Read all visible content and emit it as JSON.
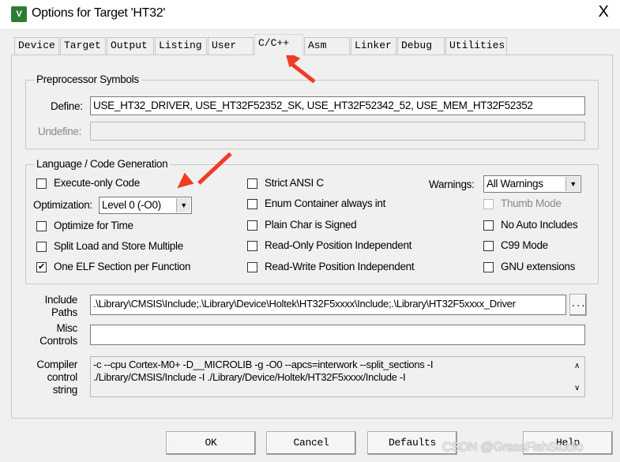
{
  "window": {
    "title": "Options for Target 'HT32'",
    "icon": "keil-uvision-icon",
    "close": "X"
  },
  "tabs": [
    {
      "label": "Device"
    },
    {
      "label": "Target"
    },
    {
      "label": "Output"
    },
    {
      "label": "Listing"
    },
    {
      "label": "User"
    },
    {
      "label": "C/C++",
      "active": true
    },
    {
      "label": "Asm"
    },
    {
      "label": "Linker"
    },
    {
      "label": "Debug"
    },
    {
      "label": "Utilities"
    }
  ],
  "preprocessor": {
    "title": "Preprocessor Symbols",
    "define_label": "Define:",
    "define_value": "USE_HT32_DRIVER, USE_HT32F52352_SK, USE_HT32F52342_52, USE_MEM_HT32F52352",
    "undefine_label": "Undefine:",
    "undefine_value": ""
  },
  "codegen": {
    "title": "Language / Code Generation",
    "execute_only": {
      "label": "Execute-only Code",
      "checked": false
    },
    "optimization_label": "Optimization:",
    "optimization_value": "Level 0 (-O0)",
    "optimize_time": {
      "label": "Optimize for Time",
      "checked": false
    },
    "split_load": {
      "label": "Split Load and Store Multiple",
      "checked": false
    },
    "one_elf": {
      "label": "One ELF Section per Function",
      "checked": true
    },
    "strict_ansi": {
      "label": "Strict ANSI C",
      "checked": false
    },
    "enum_container": {
      "label": "Enum Container always int",
      "checked": false
    },
    "plain_char": {
      "label": "Plain Char is Signed",
      "checked": false
    },
    "ro_pi": {
      "label": "Read-Only Position Independent",
      "checked": false
    },
    "rw_pi": {
      "label": "Read-Write Position Independent",
      "checked": false
    },
    "warnings_label": "Warnings:",
    "warnings_value": "All Warnings",
    "thumb_mode": {
      "label": "Thumb Mode",
      "checked": false,
      "disabled": true
    },
    "no_auto_includes": {
      "label": "No Auto Includes",
      "checked": false
    },
    "c99": {
      "label": "C99 Mode",
      "checked": false
    },
    "gnu_ext": {
      "label": "GNU extensions",
      "checked": false
    }
  },
  "include": {
    "label1": "Include",
    "label2": "Paths",
    "value": ".\\Library\\CMSIS\\Include;.\\Library\\Device\\Holtek\\HT32F5xxxx\\Include;.\\Library\\HT32F5xxxx_Driver",
    "browse": "..."
  },
  "misc": {
    "label1": "Misc",
    "label2": "Controls",
    "value": ""
  },
  "compiler": {
    "label1": "Compiler",
    "label2": "control",
    "label3": "string",
    "line1": "-c --cpu Cortex-M0+ -D__MICROLIB -g -O0 --apcs=interwork --split_sections -I",
    "line2": "./Library/CMSIS/Include -I ./Library/Device/Holtek/HT32F5xxxx/Include -I"
  },
  "buttons": {
    "ok": "OK",
    "cancel": "Cancel",
    "defaults": "Defaults",
    "help": "Help"
  },
  "watermark": "CSDN @GrassFishStudio",
  "colors": {
    "annotation_arrow": "#f03c24"
  }
}
